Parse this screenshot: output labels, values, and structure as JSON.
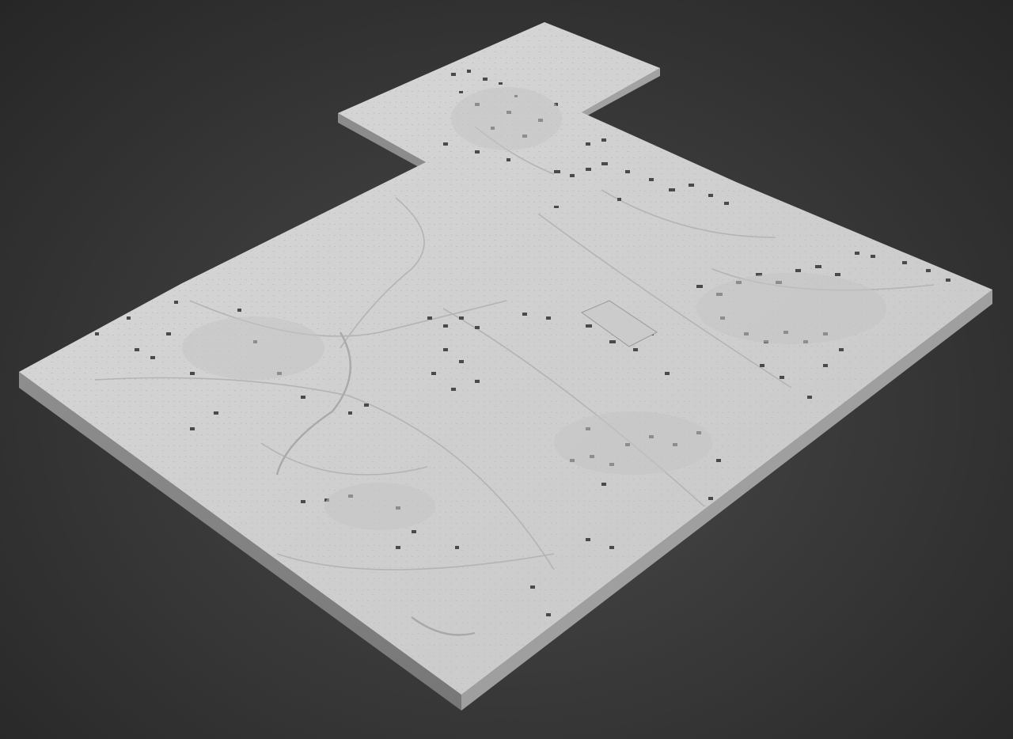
{
  "viewport": {
    "background_top": "#222222",
    "background_bottom": "#444444"
  },
  "model": {
    "description_type": "3D city relief model render",
    "surface_color": "#d2d2d2",
    "side_color": "#9a9a9a",
    "side_dark_color": "#7d7d7d",
    "building_shadow_color": "#4a4a4a"
  }
}
